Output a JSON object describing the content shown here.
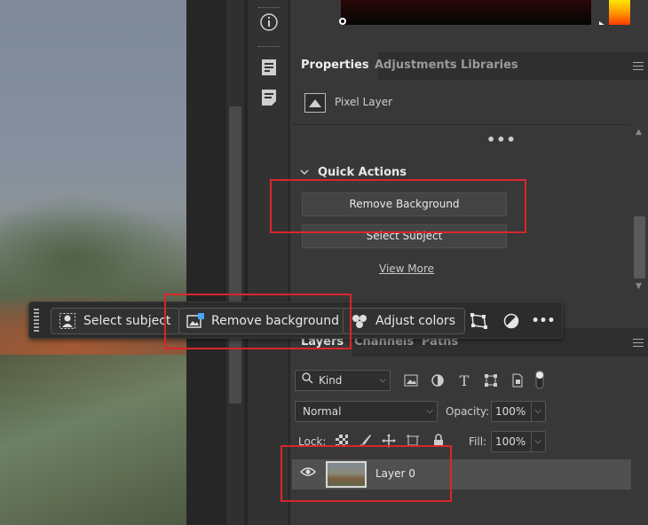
{
  "left_strip": {
    "icons": [
      "info-icon",
      "history-panel-icon",
      "notes-panel-icon"
    ]
  },
  "properties": {
    "tabs": [
      "Properties",
      "Adjustments",
      "Libraries"
    ],
    "active_tab": "Properties",
    "layer_type": "Pixel Layer",
    "more": "•••",
    "quick_actions": {
      "title": "Quick Actions",
      "buttons": [
        "Remove Background",
        "Select Subject"
      ],
      "view_more": "View More"
    }
  },
  "context_bar": {
    "buttons": [
      {
        "label": "Select subject",
        "icon": "select-subject-icon"
      },
      {
        "label": "Remove background",
        "icon": "remove-background-icon"
      },
      {
        "label": "Adjust colors",
        "icon": "adjust-colors-icon"
      }
    ],
    "icons": [
      "transform-icon",
      "adjustment-circle-icon",
      "more-icon"
    ],
    "more": "•••"
  },
  "layers": {
    "tabs": [
      "Layers",
      "Channels",
      "Paths"
    ],
    "active_tab": "Layers",
    "filter_kind": "Kind",
    "blend_mode": "Normal",
    "opacity_label": "Opacity:",
    "opacity_value": "100%",
    "lock_label": "Lock:",
    "fill_label": "Fill:",
    "fill_value": "100%",
    "items": [
      {
        "name": "Layer 0",
        "visible": true
      }
    ]
  },
  "colors": {
    "highlight": "#d9262c",
    "panel_bg": "#383838",
    "bar_bg": "#2c2c2c"
  }
}
